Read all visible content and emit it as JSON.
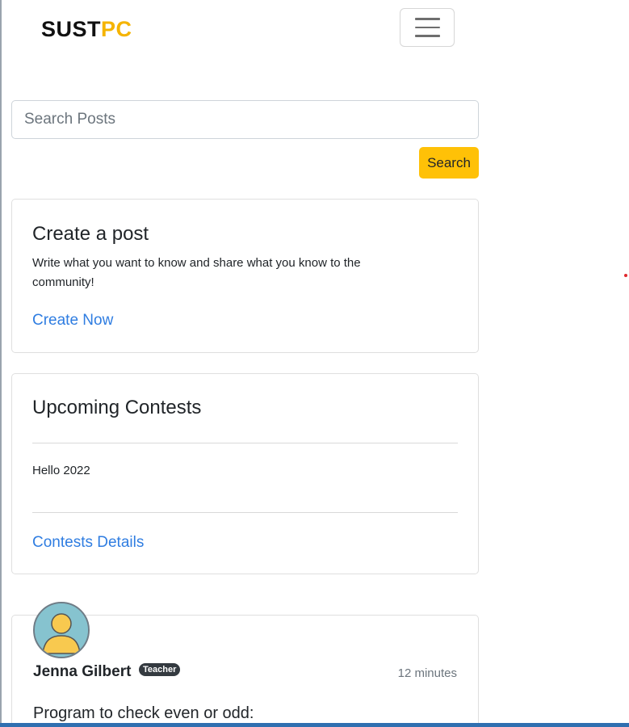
{
  "brand": {
    "part1": "SUST",
    "part2": "PC",
    "accent_color": "#f5b400"
  },
  "navbar": {
    "toggle_icon": "hamburger-menu-icon"
  },
  "search": {
    "placeholder": "Search Posts",
    "value": "",
    "button_label": "Search",
    "button_color": "#ffc107"
  },
  "create_post": {
    "title": "Create a post",
    "text": "Write what you want to know and share what you know to the community!",
    "link": "Create Now"
  },
  "contests": {
    "title": "Upcoming Contests",
    "items": [
      "Hello 2022"
    ],
    "link": "Contests Details"
  },
  "post": {
    "author": "Jenna Gilbert",
    "role_badge": "Teacher",
    "time": "12 minutes",
    "title": "Program to check even or odd:"
  },
  "colors": {
    "link": "#2f7de1",
    "badge_bg": "#343a40"
  }
}
